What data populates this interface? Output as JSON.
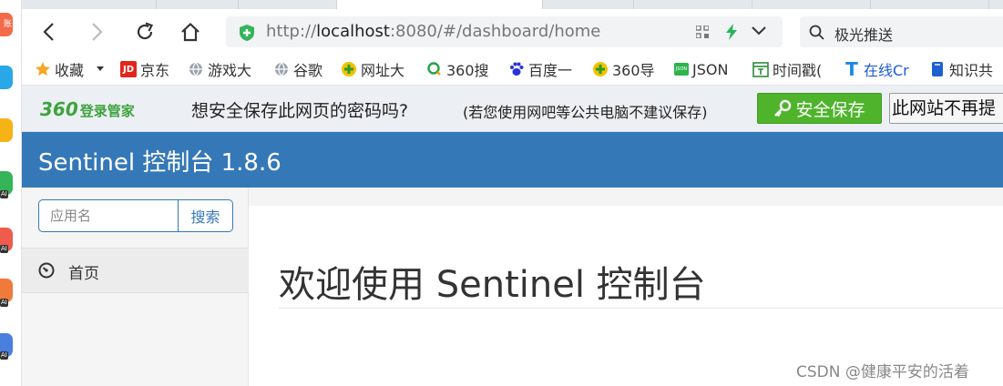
{
  "browser": {
    "url_prefix": "http://",
    "url_host": "localhost",
    "url_rest": ":8080/#/dashboard/home",
    "search_text": "极光推送",
    "side_badge_label": "账号"
  },
  "bookmarks": [
    {
      "label": "收藏",
      "icon": "star-icon"
    },
    {
      "label": "京东",
      "icon": "jd-icon"
    },
    {
      "label": "游戏大",
      "icon": "globe-icon"
    },
    {
      "label": "谷歌",
      "icon": "globe-icon"
    },
    {
      "label": "网址大",
      "icon": "plus-circle-icon"
    },
    {
      "label": "360搜",
      "icon": "search-icon"
    },
    {
      "label": "百度一",
      "icon": "paw-icon"
    },
    {
      "label": "360导",
      "icon": "plus-circle-icon"
    },
    {
      "label": "JSON",
      "icon": "json-icon"
    },
    {
      "label": "时间戳(",
      "icon": "calendar-icon"
    },
    {
      "label": "在线Cr",
      "icon": "t-icon"
    },
    {
      "label": "知识共",
      "icon": "book-icon"
    }
  ],
  "password_bar": {
    "brand_number": "360",
    "brand_text": "登录管家",
    "question": "想安全保存此网页的密码吗?",
    "hint": "(若您使用网吧等公共电脑不建议保存)",
    "save_label": "安全保存",
    "never_label": "此网站不再提"
  },
  "app": {
    "title": "Sentinel 控制台 1.8.6",
    "search_placeholder": "应用名",
    "search_button": "搜索",
    "nav_home": "首页",
    "welcome": "欢迎使用 Sentinel 控制台"
  },
  "watermark": "CSDN @健康平安的活着",
  "colors": {
    "header_blue": "#3578b8",
    "save_green": "#4fb42c",
    "brand_green": "#3ea33e"
  }
}
